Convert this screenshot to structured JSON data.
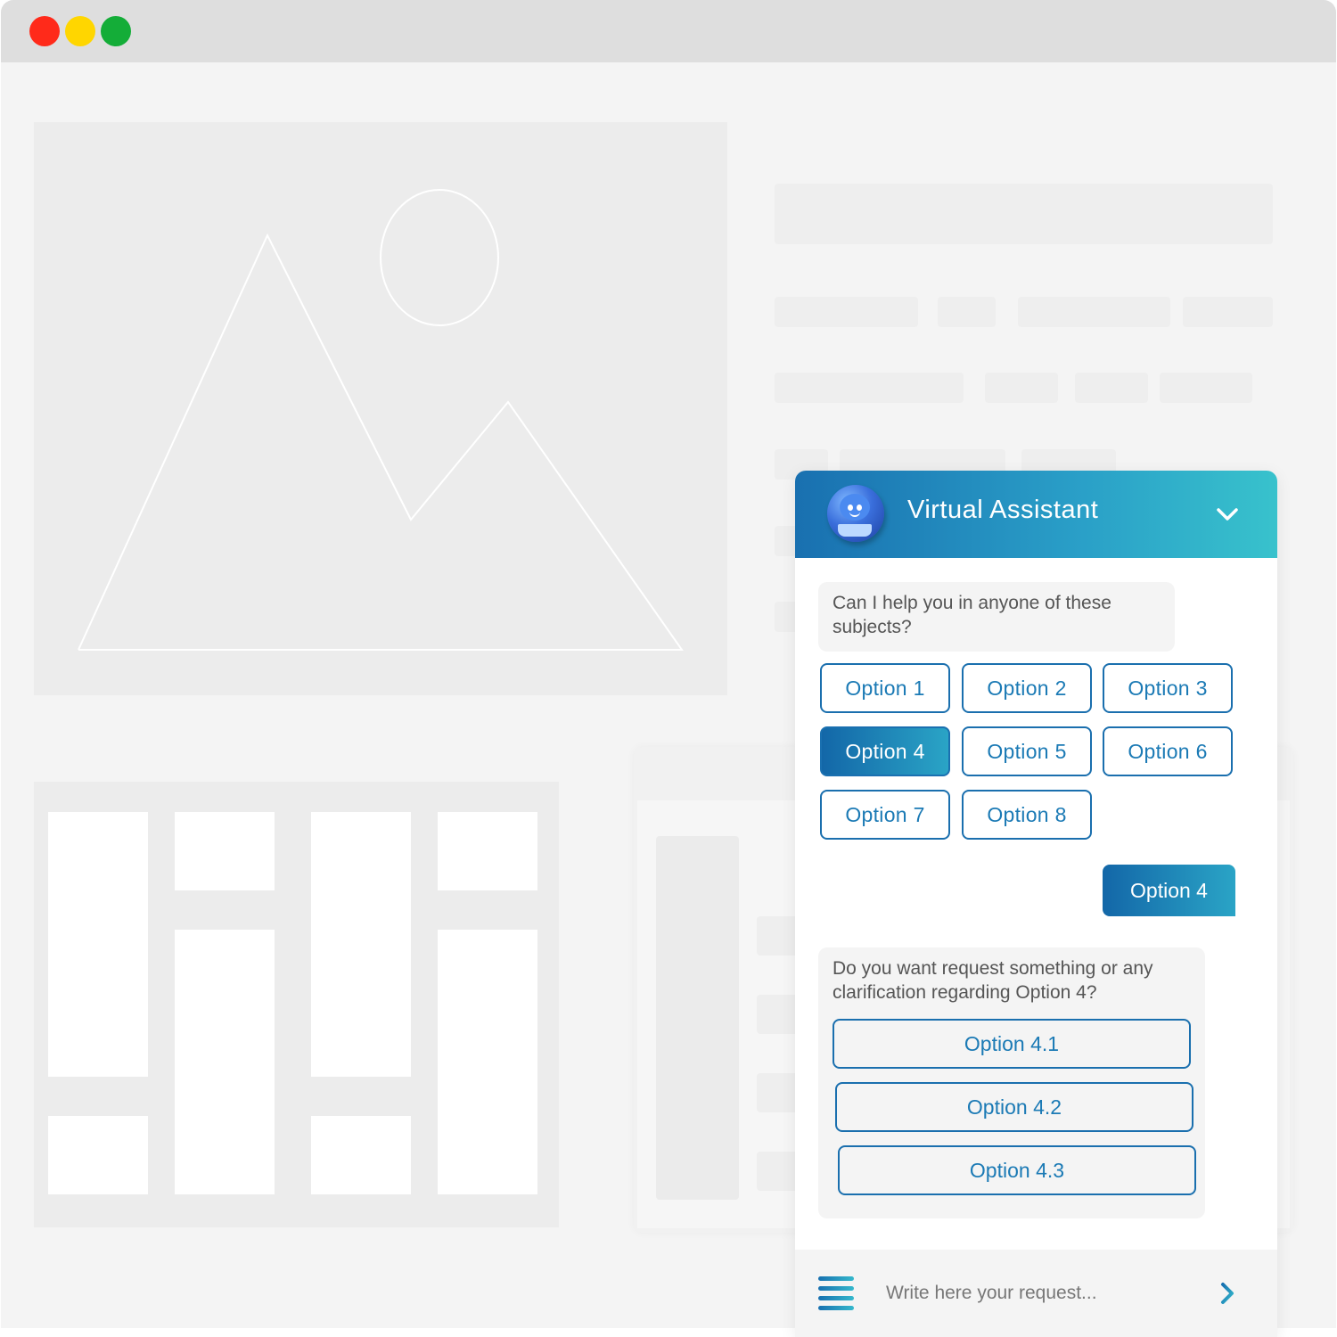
{
  "window": {
    "controls": [
      "close",
      "minimize",
      "maximize"
    ],
    "control_colors": {
      "close": "#ff2a1a",
      "minimize": "#ffd600",
      "maximize": "#14ad38"
    }
  },
  "chat": {
    "title": "Virtual Assistant",
    "header_gradient": [
      "#1970b0",
      "#38c2cc"
    ],
    "first_question": "Can I help you in anyone of these subjects?",
    "options": [
      "Option 1",
      "Option 2",
      "Option 3",
      "Option 4",
      "Option 5",
      "Option 6",
      "Option 7",
      "Option 8"
    ],
    "selected_option": "Option 4",
    "user_reply": "Option 4",
    "second_question": "Do you want request something or any clarification regarding Option 4?",
    "sub_options": [
      "Option 4.1",
      "Option 4.2",
      "Option 4.3"
    ],
    "input_placeholder": "Write here your request...",
    "icons": {
      "avatar": "bot-avatar",
      "collapse": "chevron-down-icon",
      "menu": "menu-icon",
      "send": "chevron-right-icon"
    }
  }
}
